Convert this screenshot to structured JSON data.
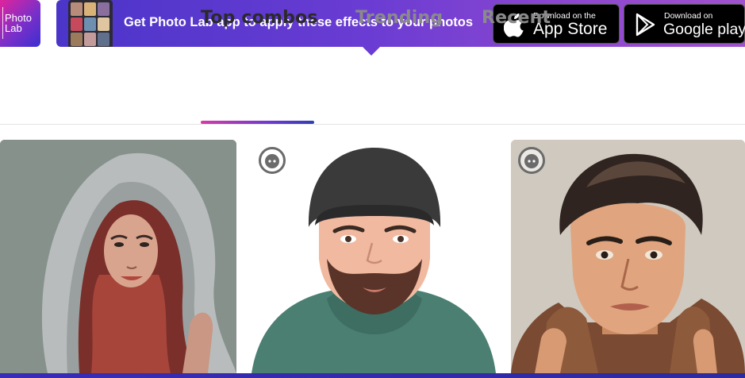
{
  "logo": {
    "line1": "Photo",
    "line2": "Lab"
  },
  "banner": {
    "message": "Get Photo Lab app to apply these effects to your photos",
    "app_store": {
      "small": "Download on the",
      "big": "App Store"
    },
    "google_play": {
      "small": "Download on",
      "big": "Google play"
    },
    "gradient_start": "#4b35c9",
    "gradient_end": "#a052cc"
  },
  "tabs": [
    {
      "label": "Top combos",
      "active": true
    },
    {
      "label": "Trending",
      "active": false
    },
    {
      "label": "Recent",
      "active": false
    }
  ],
  "cards": [
    {
      "subject": "woman-in-hood-painting",
      "badge": false
    },
    {
      "subject": "cartoon-bearded-man",
      "badge": true,
      "badge_icon": "avatar-face-icon"
    },
    {
      "subject": "man-in-jacket-painting",
      "badge": true,
      "badge_icon": "avatar-face-icon"
    }
  ],
  "colors": {
    "accent_start": "#d63ba6",
    "accent_end": "#2f3fb5",
    "tab_active": "#2a2a2a",
    "tab_inactive": "#8a8a8a"
  }
}
